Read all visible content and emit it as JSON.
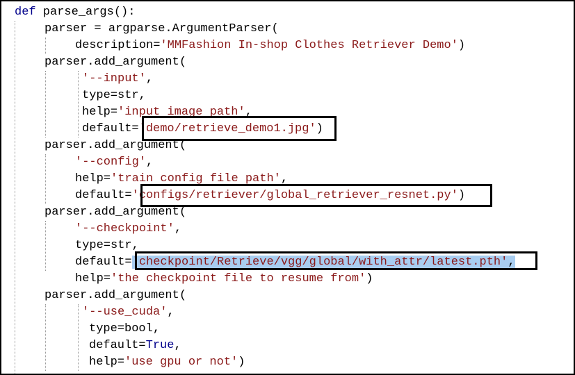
{
  "code": {
    "l1": {
      "kw": "def",
      "rest": " parse_args():"
    },
    "l2": {
      "text": "parser = argparse.ArgumentParser("
    },
    "l3": {
      "pre": "description=",
      "str": "'MMFashion In-shop Clothes Retriever Demo'",
      "post": ")"
    },
    "l4": {
      "text": "parser.add_argument("
    },
    "l5": {
      "str": "'--input'",
      "post": ","
    },
    "l6": {
      "text": "type=str,"
    },
    "l7": {
      "pre": "help=",
      "str": "'input image path'",
      "post": ","
    },
    "l8": {
      "pre": "default=",
      "str": "'demo/retrieve_demo1.jpg'",
      "post": ")"
    },
    "l9": {
      "text": "parser.add_argument("
    },
    "l10": {
      "str": "'--config'",
      "post": ","
    },
    "l11": {
      "pre": "help=",
      "str": "'train config file path'",
      "post": ","
    },
    "l12": {
      "pre": "default=",
      "str": "'configs/retriever/global_retriever_resnet.py'",
      "post": ")"
    },
    "l13": {
      "text": "parser.add_argument("
    },
    "l14": {
      "str": "'--checkpoint'",
      "post": ","
    },
    "l15": {
      "text": "type=str,"
    },
    "l16": {
      "pre": "default=",
      "str": "'checkpoint/Retrieve/vgg/global/with_attr/latest.pth'",
      "post": ","
    },
    "l17": {
      "pre": "help=",
      "str": "'the checkpoint file to resume from'",
      "post": ")"
    },
    "l18": {
      "text": "parser.add_argument("
    },
    "l19": {
      "str": "'--use_cuda'",
      "post": ","
    },
    "l20": {
      "text": "type=bool,"
    },
    "l21": {
      "pre": "default=",
      "kw": "True",
      "post": ","
    },
    "l22": {
      "pre": "help=",
      "str": "'use gpu or not'",
      "post": ")"
    }
  },
  "colors": {
    "keyword": "#00008b",
    "string": "#8b1a1a",
    "selection": "#a8cdf0"
  }
}
